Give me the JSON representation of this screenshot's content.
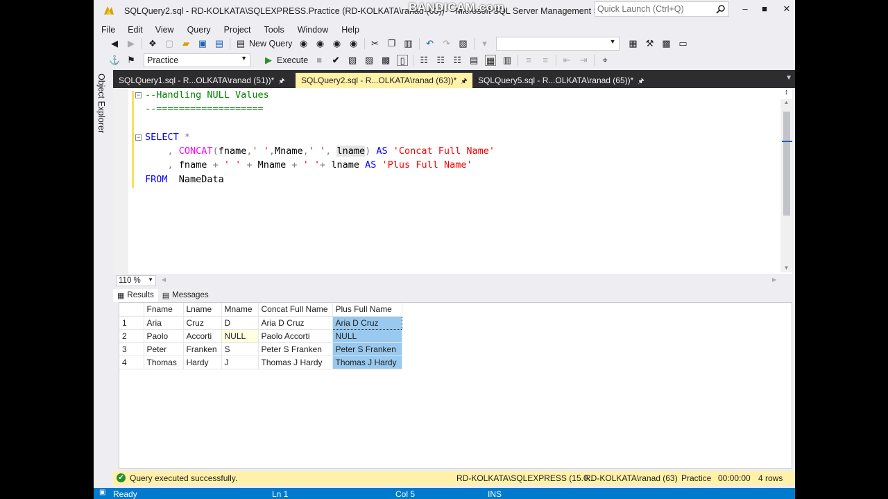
{
  "window": {
    "title": "SQLQuery2.sql - RD-KOLKATA\\SQLEXPRESS.Practice (RD-KOLKATA\\ranad (63))* - Microsoft SQL Server Management Studio",
    "watermark": "BANDICAM.com",
    "quick_launch_placeholder": "Quick Launch (Ctrl+Q)"
  },
  "menu": [
    "File",
    "Edit",
    "View",
    "Query",
    "Project",
    "Tools",
    "Window",
    "Help"
  ],
  "toolbar": {
    "new_query": "New Query",
    "execute": "Execute",
    "database": "Practice"
  },
  "rail": {
    "object_explorer": "Object Explorer"
  },
  "tabs": [
    {
      "label": "SQLQuery1.sql - R...OLKATA\\ranad (51))*"
    },
    {
      "label": "SQLQuery2.sql - R...OLKATA\\ranad (63))*"
    },
    {
      "label": "SQLQuery5.sql - R...OLKATA\\ranad (65))*"
    }
  ],
  "editor": {
    "comment1": "--Handling NULL Values",
    "comment2": "--===================",
    "select": "SELECT",
    "star": "*"
  },
  "zoom": "110 %",
  "results_tabs": {
    "results": "Results",
    "messages": "Messages"
  },
  "grid": {
    "columns": [
      "Fname",
      "Lname",
      "Mname",
      "Concat Full Name",
      "Plus Full Name"
    ],
    "rows": [
      {
        "n": "1",
        "fname": "Aria",
        "lname": "Cruz",
        "mname": "D",
        "concat": "Aria D Cruz",
        "plus": "Aria D Cruz"
      },
      {
        "n": "2",
        "fname": "Paolo",
        "lname": "Accorti",
        "mname": "NULL",
        "concat": "Paolo  Accorti",
        "plus": "NULL"
      },
      {
        "n": "3",
        "fname": "Peter",
        "lname": "Franken",
        "mname": "S",
        "concat": "Peter S Franken",
        "plus": "Peter S Franken"
      },
      {
        "n": "4",
        "fname": "Thomas",
        "lname": "Hardy",
        "mname": "J",
        "concat": "Thomas J Hardy",
        "plus": "Thomas J Hardy"
      }
    ]
  },
  "query_status": {
    "message": "Query executed successfully.",
    "server": "RD-KOLKATA\\SQLEXPRESS (15.0...",
    "user": "RD-KOLKATA\\ranad (63)",
    "database": "Practice",
    "elapsed": "00:00:00",
    "rows": "4 rows"
  },
  "status_bar": {
    "ready": "Ready",
    "ln": "Ln 1",
    "col": "Col 5",
    "ins": "INS"
  }
}
